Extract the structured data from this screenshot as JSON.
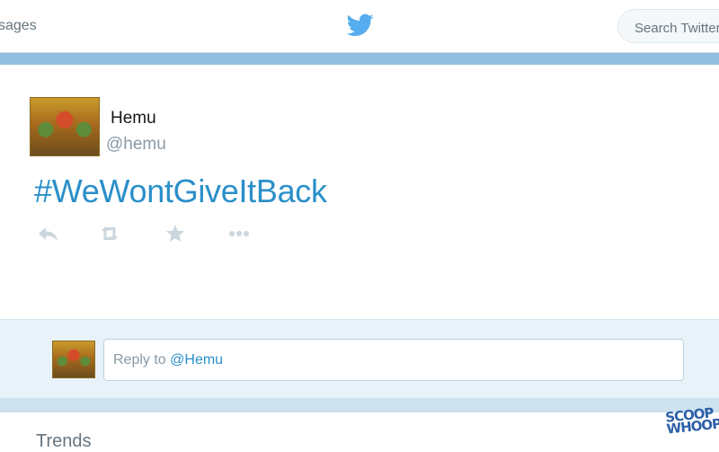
{
  "nav": {
    "messages_label": "sages",
    "bird_icon": "twitter-bird-icon",
    "search_placeholder": "Search Twitter"
  },
  "tweet": {
    "name": "Hemu",
    "handle": "@hemu",
    "text": "#WeWontGiveItBack",
    "actions": [
      "reply-icon",
      "retweet-icon",
      "favorite-icon",
      "more-icon"
    ]
  },
  "reply": {
    "prefix": "Reply to",
    "mention": "@Hemu"
  },
  "sidebar": {
    "trends_title": "Trends"
  },
  "watermark": {
    "line1": "SCOOP",
    "line2": "WHOOP"
  },
  "colors": {
    "accent": "#2a8fc9",
    "strip": "#8fbfdc",
    "reply_bg": "#e8f2f9",
    "icon_gray": "#ccd6dd"
  }
}
